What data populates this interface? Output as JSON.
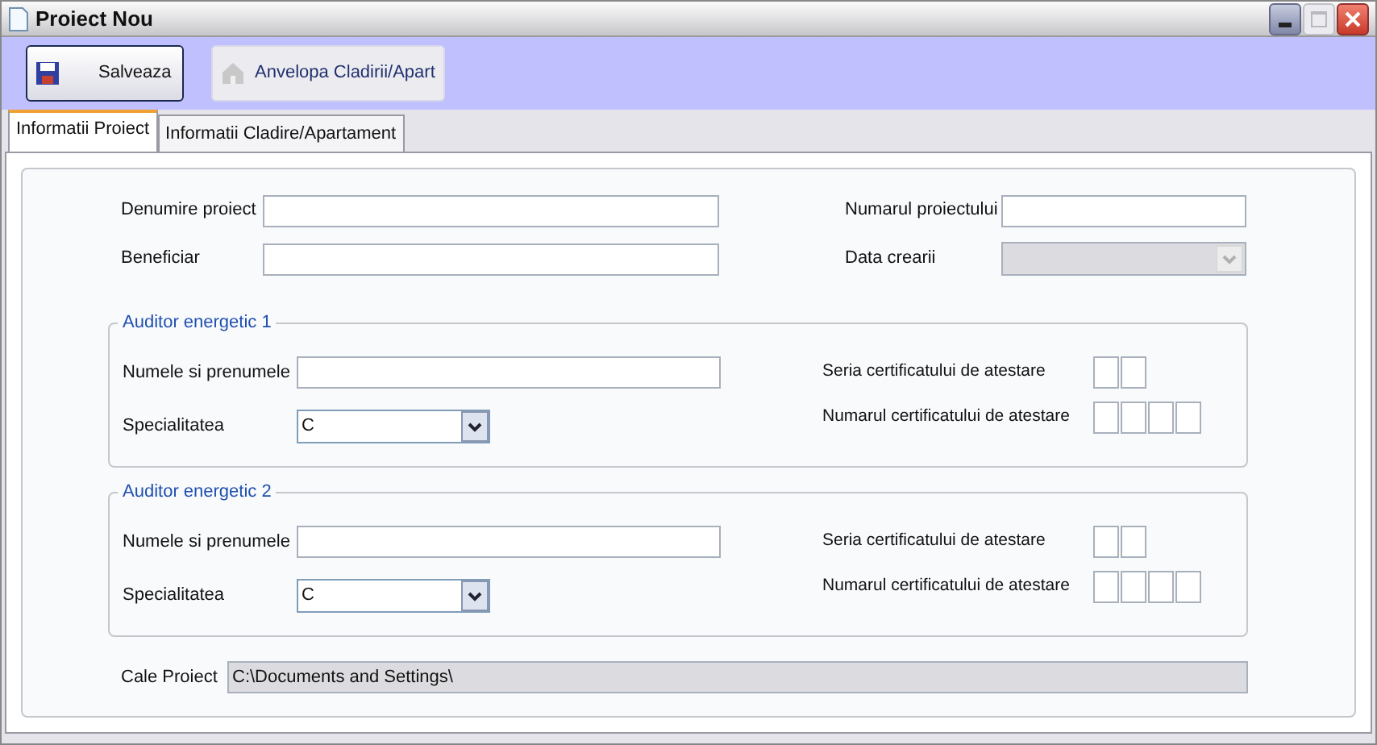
{
  "window": {
    "title": "Proiect Nou"
  },
  "toolbar": [
    {
      "label": "Salveaza",
      "kind": "save",
      "disabled": false
    },
    {
      "label": "Anvelopa Cladirii/Apart",
      "kind": "house",
      "disabled": true
    }
  ],
  "tabs": [
    {
      "label": "Informatii Proiect",
      "selected": true
    },
    {
      "label": "Informatii Cladire/Apartament",
      "selected": false
    }
  ],
  "left_fields": [
    {
      "label": "Denumire proiect"
    },
    {
      "label": "Beneficiar"
    }
  ],
  "right_fields": [
    {
      "label": "Numarul proiectului",
      "kind": "text",
      "disabled": false
    },
    {
      "label": "Data crearii",
      "kind": "date",
      "disabled": true
    }
  ],
  "auditors": [
    {
      "title": "Auditor energetic 1",
      "name_label": "Numele si prenumele",
      "specialty_label": "Specialitatea",
      "specialty_value": "C",
      "series_label": "Seria certificatului de atestare",
      "number_label": "Numarul certificatului de atestare"
    },
    {
      "title": "Auditor energetic 2",
      "name_label": "Numele si prenumele",
      "specialty_label": "Specialitatea",
      "specialty_value": "C",
      "series_label": "Seria certificatului de atestare",
      "number_label": "Numarul certificatului de atestare"
    }
  ],
  "path": {
    "label": "Cale Proiect",
    "value": "C:\\Documents and Settings\\"
  }
}
